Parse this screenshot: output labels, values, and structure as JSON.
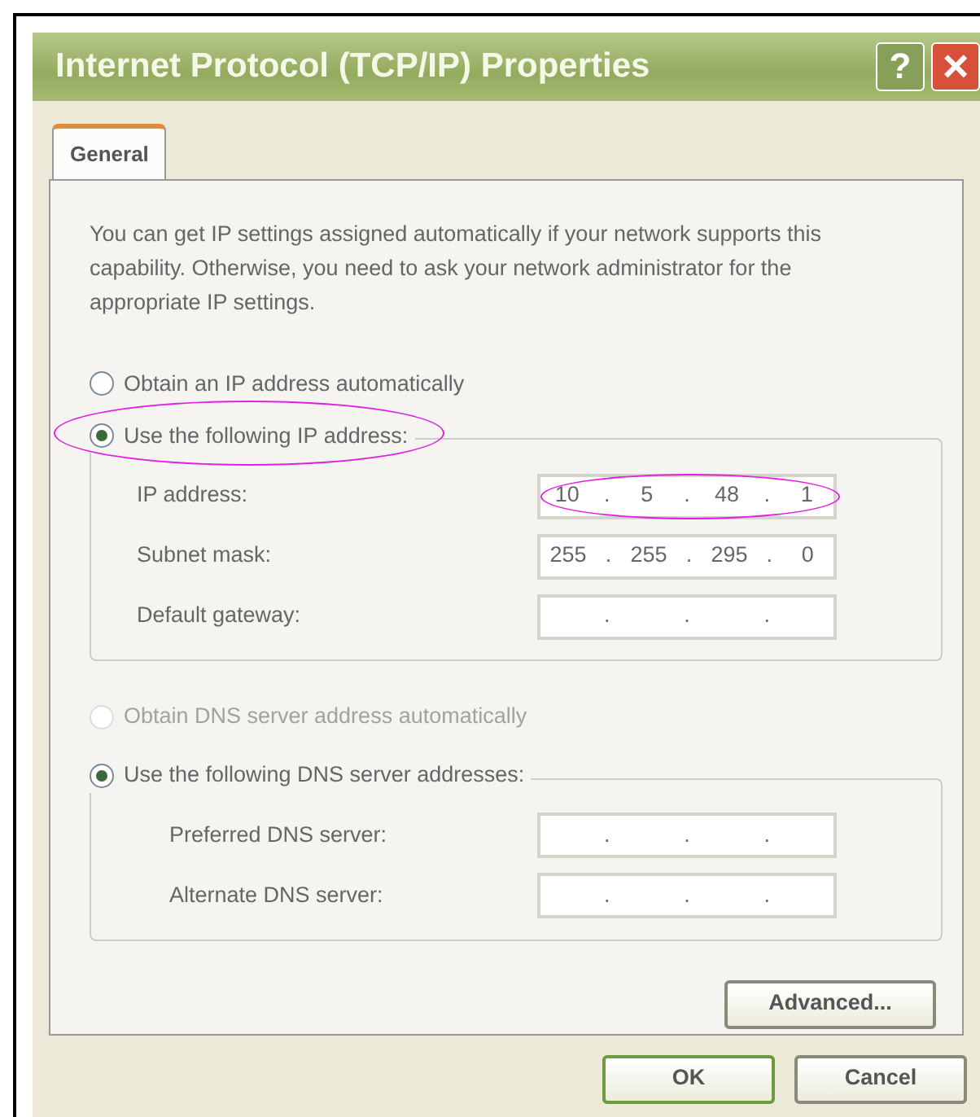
{
  "window": {
    "title": "Internet Protocol (TCP/IP) Properties",
    "help_button": "?",
    "close_button": "×"
  },
  "tabs": [
    {
      "label": "General",
      "selected": true
    }
  ],
  "intro": "You can get IP settings assigned automatically if your network supports this capability. Otherwise, you need to ask your network administrator for the appropriate IP settings.",
  "ip_options": [
    {
      "label": "Obtain an IP address automatically",
      "selected": false,
      "disabled": false
    },
    {
      "label": "Use the following IP address:",
      "selected": true,
      "disabled": false,
      "circled": true
    }
  ],
  "ip_fields": [
    {
      "label": "IP address:",
      "separator": ".",
      "octets": [
        "10",
        "5",
        "48",
        "1"
      ],
      "circled": true
    },
    {
      "label": "Subnet mask:",
      "separator": ".",
      "octets": [
        "255",
        "255",
        "295",
        "0"
      ]
    },
    {
      "label": "Default gateway:",
      "separator": "."
    }
  ],
  "dns_options": [
    {
      "label": "Obtain DNS server address automatically",
      "selected": false,
      "disabled": true
    },
    {
      "label": "Use the following DNS server addresses:",
      "selected": true,
      "disabled": false
    }
  ],
  "dns_fields": [
    {
      "label": "Preferred DNS server:",
      "separator": "."
    },
    {
      "label": "Alternate DNS server:",
      "separator": "."
    }
  ],
  "advanced_button": "Advanced...",
  "buttons": [
    {
      "label": "OK",
      "default": true
    },
    {
      "label": "Cancel",
      "default": false
    }
  ]
}
